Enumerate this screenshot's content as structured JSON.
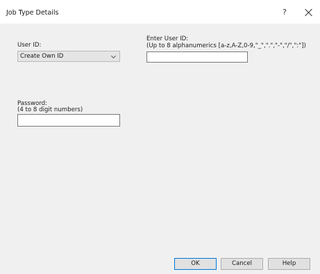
{
  "window": {
    "title": "Job Type Details",
    "help_label": "?",
    "close_label": "×"
  },
  "user_id": {
    "label": "User ID:",
    "selected": "Create Own ID"
  },
  "enter_user_id": {
    "label": "Enter User ID:",
    "hint": "(Up to 8 alphanumerics [a-z,A-Z,0-9,\"_\",\".\",\"-\",\"/\",\":\"])",
    "value": ""
  },
  "password": {
    "label": "Password:",
    "hint": "(4 to 8 digit numbers)",
    "value": ""
  },
  "buttons": {
    "ok": "OK",
    "cancel": "Cancel",
    "help": "Help"
  },
  "icons": {
    "close": "close-icon",
    "dropdown": "chevron-down-icon"
  }
}
